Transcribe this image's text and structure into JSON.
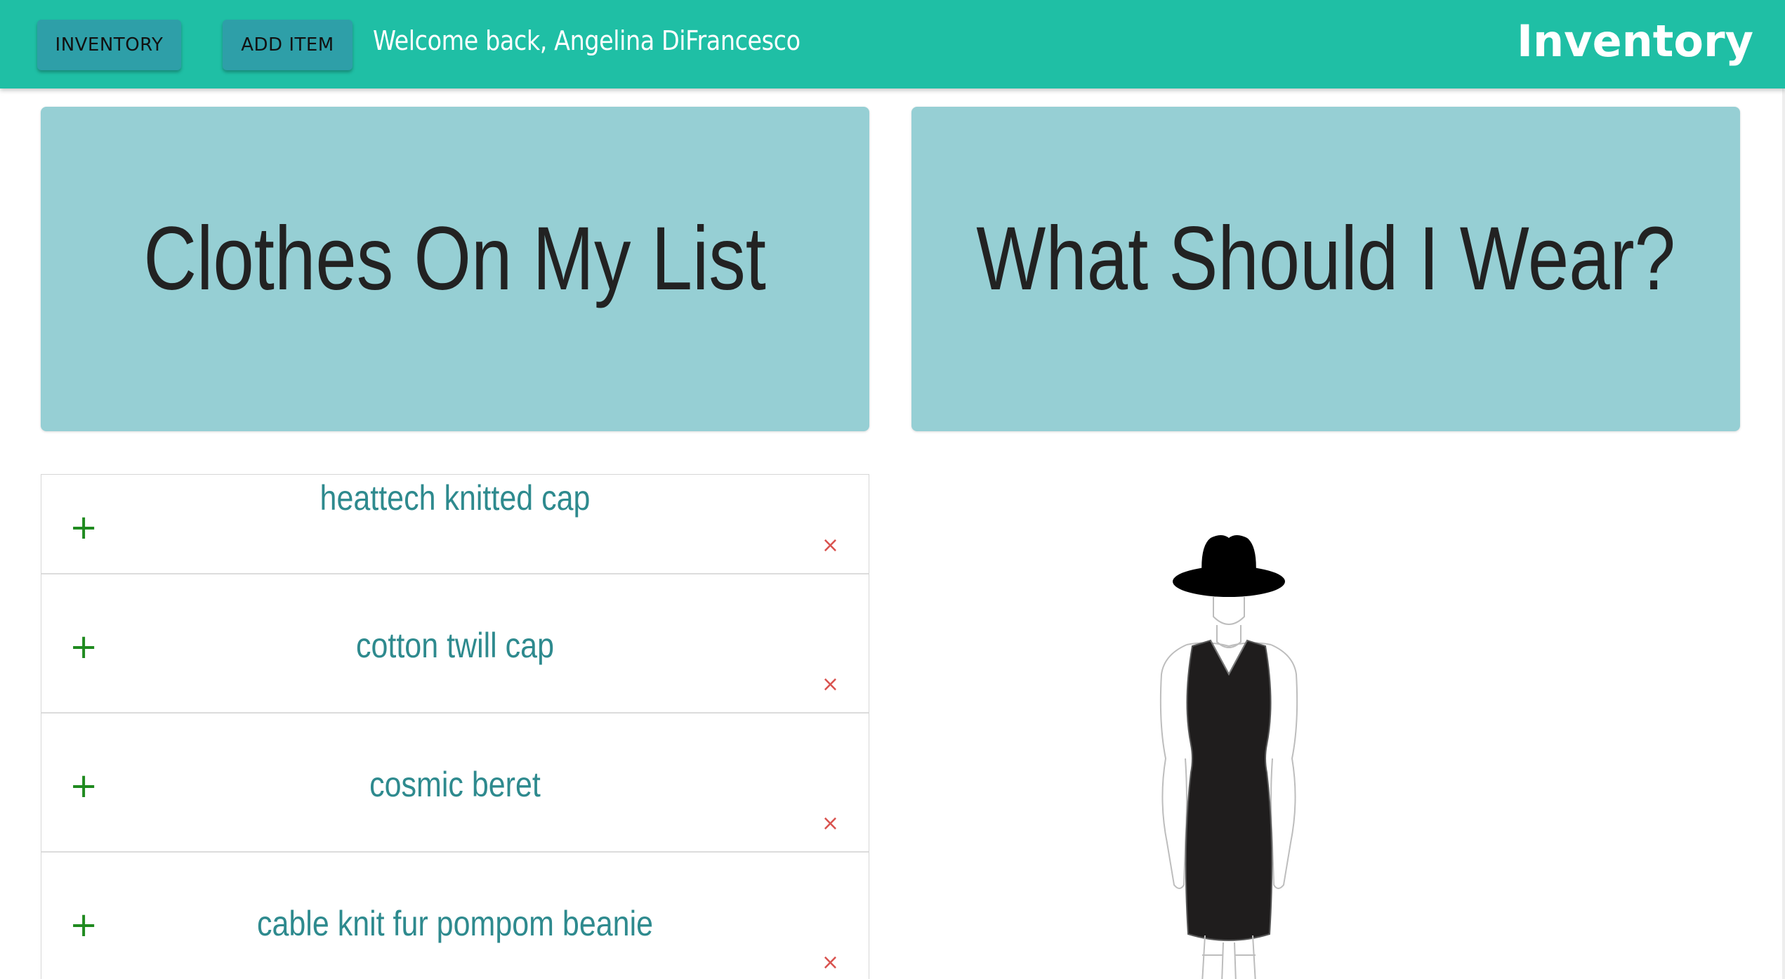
{
  "nav": {
    "inventory_label": "INVENTORY",
    "add_item_label": "ADD ITEM",
    "welcome_text": "Welcome back, Angelina DiFrancesco",
    "brand": "Inventory"
  },
  "cards": {
    "left_title": "Clothes On My List",
    "right_title": "What Should I Wear?"
  },
  "list": {
    "add_symbol": "+",
    "remove_symbol": "×",
    "items": [
      {
        "name": "heattech knitted cap"
      },
      {
        "name": "cotton twill cap"
      },
      {
        "name": "cosmic beret"
      },
      {
        "name": "cable knit fur pompom beanie"
      }
    ]
  },
  "colors": {
    "navbar": "#1fbfa5",
    "nav_button": "#2e9fa8",
    "card": "#96cfd4",
    "item_text": "#2e8a8e",
    "add_icon": "#1f8a1f",
    "remove_icon": "#d9534f"
  },
  "icons": {
    "add": "plus-icon",
    "remove": "close-icon",
    "outfit": "mannequin-figure"
  }
}
